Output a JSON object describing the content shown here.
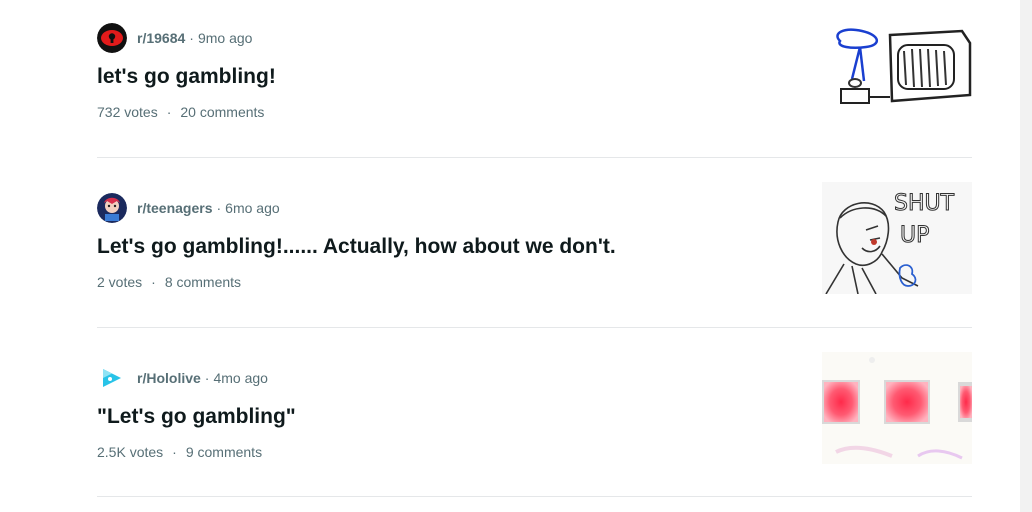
{
  "posts": [
    {
      "subreddit": "r/19684",
      "separator": "·",
      "age": "9mo ago",
      "title": "let's go gambling!",
      "votes": "732 votes",
      "stats_separator": "·",
      "comments": "20 comments",
      "avatar_icon": "red-eye-keyhole-icon",
      "thumbnail": "slot-machine-sketch"
    },
    {
      "subreddit": "r/teenagers",
      "separator": "·",
      "age": "6mo ago",
      "title": "Let's go gambling!...... Actually, how about we don't.",
      "votes": "2 votes",
      "stats_separator": "·",
      "comments": "8 comments",
      "avatar_icon": "teenagers-character-icon",
      "thumbnail": "shut-up-sketch",
      "thumbnail_text": "SHUT UP"
    },
    {
      "subreddit": "r/Hololive",
      "separator": "·",
      "age": "4mo ago",
      "title": "\"Let's go gambling\"",
      "votes": "2.5K votes",
      "stats_separator": "·",
      "comments": "9 comments",
      "avatar_icon": "hololive-play-logo-icon",
      "thumbnail": "red-squares-image"
    }
  ],
  "colors": {
    "meta_text": "#576f76",
    "title_text": "#0f1a1c",
    "divider": "#e5e7e9"
  }
}
